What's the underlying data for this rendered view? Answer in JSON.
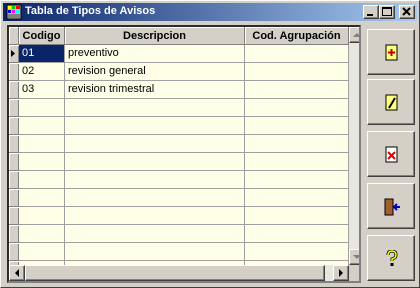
{
  "window": {
    "title": "Tabla de Tipos de Avisos"
  },
  "table": {
    "columns": [
      "Codigo",
      "Descripcion",
      "Cod. Agrupación"
    ],
    "rows": [
      {
        "codigo": "01",
        "descripcion": "preventivo",
        "agrupacion": ""
      },
      {
        "codigo": "02",
        "descripcion": "revision general",
        "agrupacion": ""
      },
      {
        "codigo": "03",
        "descripcion": "revision trimestral",
        "agrupacion": ""
      }
    ],
    "selected_row": 0,
    "colors": {
      "background": "#ffffe8",
      "selection": "#0a246a"
    }
  },
  "side_buttons": [
    {
      "icon": "add-record-icon"
    },
    {
      "icon": "edit-record-icon"
    },
    {
      "icon": "delete-record-icon"
    },
    {
      "icon": "exit-door-icon"
    },
    {
      "icon": "help-question-icon"
    }
  ]
}
